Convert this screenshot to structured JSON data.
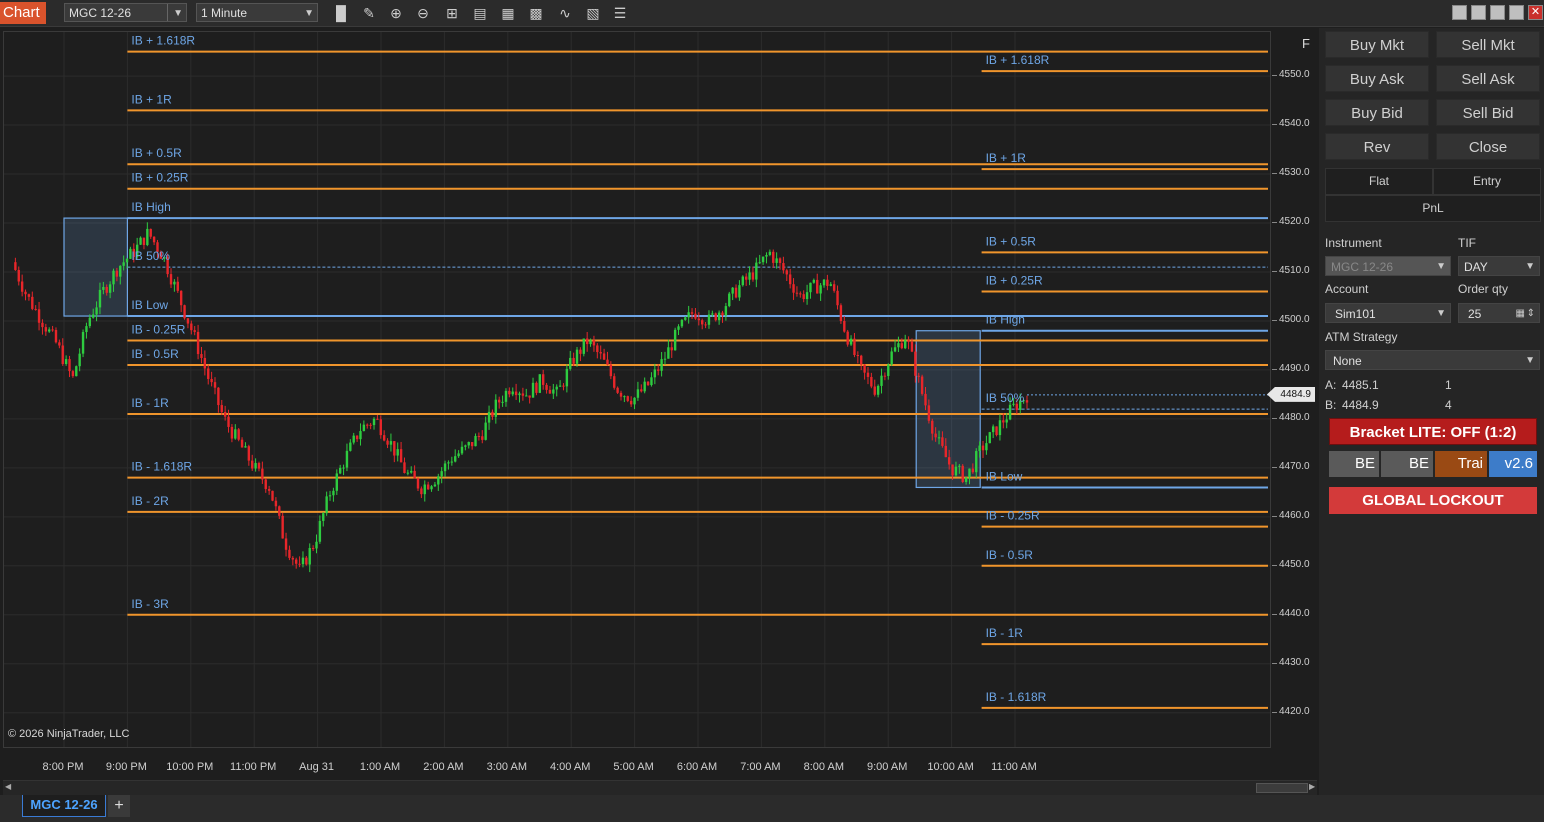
{
  "toolbar": {
    "chart_tab": "Chart",
    "instrument": "MGC 12-26",
    "interval": "1 Minute",
    "tool_icons": [
      "bar-type-icon",
      "draw-pencil-icon",
      "zoom-in-icon",
      "zoom-out-icon",
      "crosshair-icon",
      "properties-icon",
      "template-icon",
      "data-box-icon",
      "strategy-icon",
      "indicator-icon",
      "menu-icon"
    ]
  },
  "chart": {
    "copyright": "© 2026 NinjaTrader, LLC",
    "f_button": "F",
    "current_price": "4484.9",
    "y_ticks": [
      "4550.0",
      "4540.0",
      "4530.0",
      "4520.0",
      "4510.0",
      "4500.0",
      "4490.0",
      "4480.0",
      "4470.0",
      "4460.0",
      "4450.0",
      "4440.0",
      "4430.0",
      "4420.0"
    ],
    "x_ticks": [
      "8:00 PM",
      "9:00 PM",
      "10:00 PM",
      "11:00 PM",
      "Aug 31",
      "1:00 AM",
      "2:00 AM",
      "3:00 AM",
      "4:00 AM",
      "5:00 AM",
      "6:00 AM",
      "7:00 AM",
      "8:00 AM",
      "9:00 AM",
      "10:00 AM",
      "11:00 AM"
    ],
    "ib_session1_labels": [
      "IB + 1.618R",
      "IB + 1R",
      "IB + 0.5R",
      "IB + 0.25R",
      "IB High",
      "IB 50%",
      "IB Low",
      "IB - 0.25R",
      "IB - 0.5R",
      "IB - 1R",
      "IB - 1.618R",
      "IB - 2R",
      "IB - 3R"
    ],
    "ib_session2_labels": [
      "IB + 1.618R",
      "IB + 1R",
      "IB + 0.5R",
      "IB + 0.25R",
      "IB High",
      "IB 50%",
      "IB Low",
      "IB - 0.25R",
      "IB - 0.5R",
      "IB - 1R",
      "IB - 1.618R"
    ],
    "colors": {
      "up": "#2ecc40",
      "down": "#e8262a",
      "level": "#f0952c",
      "ib": "#6ea6e6"
    }
  },
  "chart_data": {
    "type": "candlestick",
    "title": "",
    "instrument": "MGC 12-26",
    "interval": "1 Minute",
    "ylim": [
      4410,
      4556
    ],
    "x": [
      "8:00 PM",
      "9:00 PM",
      "10:00 PM",
      "11:00 PM",
      "Aug 31",
      "1:00 AM",
      "2:00 AM",
      "3:00 AM",
      "4:00 AM",
      "5:00 AM",
      "6:00 AM",
      "7:00 AM",
      "8:00 AM",
      "9:00 AM",
      "10:00 AM",
      "11:00 AM"
    ],
    "approx_close_path": [
      4512,
      4505,
      4500,
      4495,
      4488,
      4500,
      4506,
      4511,
      4514,
      4518,
      4513,
      4505,
      4497,
      4488,
      4480,
      4475,
      4470,
      4466,
      4455,
      4449,
      4455,
      4465,
      4472,
      4478,
      4480,
      4475,
      4469,
      4466,
      4468,
      4472,
      4474,
      4477,
      4483,
      4487,
      4485,
      4488,
      4485,
      4492,
      4496,
      4492,
      4486,
      4484,
      4487,
      4492,
      4498,
      4502,
      4500,
      4503,
      4507,
      4510,
      4514,
      4510,
      4505,
      4507,
      4508,
      4498,
      4490,
      4486,
      4493,
      4497,
      4486,
      4476,
      4470,
      4468,
      4474,
      4478,
      4482,
      4484.9
    ],
    "ib_levels_session1": {
      "IB + 1.618R": 4555,
      "IB + 1R": 4543,
      "IB + 0.5R": 4532,
      "IB + 0.25R": 4527,
      "IB High": 4521,
      "IB 50%": 4511,
      "IB Low": 4501,
      "IB - 0.25R": 4496,
      "IB - 0.5R": 4491,
      "IB - 1R": 4481,
      "IB - 1.618R": 4468,
      "IB - 2R": 4461,
      "IB - 3R": 4440
    },
    "ib_levels_session2": {
      "IB + 1.618R": 4551,
      "IB + 1R": 4531,
      "IB + 0.5R": 4514,
      "IB + 0.25R": 4506,
      "IB High": 4498,
      "IB 50%": 4482,
      "IB Low": 4466,
      "IB - 0.25R": 4458,
      "IB - 0.5R": 4450,
      "IB - 1R": 4434,
      "IB - 1.618R": 4421
    },
    "last_price": 4484.9
  },
  "panel": {
    "buy_mkt": "Buy Mkt",
    "sell_mkt": "Sell Mkt",
    "buy_ask": "Buy Ask",
    "sell_ask": "Sell Ask",
    "buy_bid": "Buy Bid",
    "sell_bid": "Sell Bid",
    "rev": "Rev",
    "close": "Close",
    "flat": "Flat",
    "entry": "Entry",
    "pnl": "PnL",
    "instrument_label": "Instrument",
    "instrument_value": "MGC 12-26",
    "tif_label": "TIF",
    "tif_value": "DAY",
    "account_label": "Account",
    "account_value": "Sim101",
    "order_qty_label": "Order qty",
    "order_qty_value": "25",
    "atm_label": "ATM Strategy",
    "atm_value": "None",
    "ask_label": "A:",
    "ask_price": "4485.1",
    "ask_size": "1",
    "bid_label": "B:",
    "bid_price": "4484.9",
    "bid_size": "4",
    "bracket": "Bracket LITE: OFF (1:2)",
    "be1": "BE",
    "be2": "BE",
    "trail": "Trai",
    "version": "v2.6",
    "lockout": "GLOBAL LOCKOUT"
  },
  "bottom": {
    "instrument_tab": "MGC 12-26",
    "add_tab": "+"
  }
}
